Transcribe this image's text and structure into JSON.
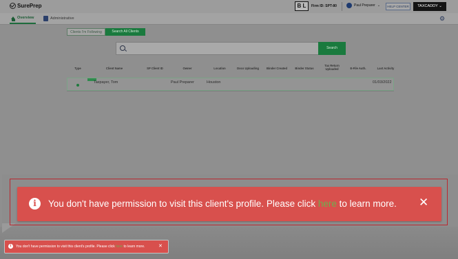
{
  "header": {
    "logo_text": "SurePrep",
    "firm_badge": "B L",
    "firm_id": "Firm ID: SPT-80",
    "user_name": "Paul Preparer",
    "help_label": "HELP CENTER",
    "brand_menu_label": "TAXCADDY"
  },
  "nav": {
    "tabs": [
      {
        "label": "Overview",
        "icon": "home-icon",
        "active": true
      },
      {
        "label": "Administrative",
        "icon": "id-card-icon",
        "active": false
      }
    ],
    "settings_icon": "gear-icon"
  },
  "toggle": {
    "following_label": "Clients I'm Following",
    "all_label": "Search All Clients"
  },
  "search": {
    "placeholder": "",
    "button_label": "Search"
  },
  "table": {
    "columns": [
      "Type",
      "Client Name",
      "SP Client ID",
      "Owner",
      "Location",
      "Docs Uploading",
      "Binder Created",
      "Binder Status",
      "Tax Return Uploaded",
      "E-File Auth.",
      "Last Activity"
    ],
    "rows": [
      {
        "client_name": "Taxpayer, Tom",
        "sp_client_id": "",
        "owner": "Paul Preparer",
        "location": "Houston",
        "last_activity": "01/03/2022"
      }
    ]
  },
  "toast": {
    "message_before": "You don't have permission to visit this client's profile. Please click ",
    "link_text": "here",
    "message_after": " to learn more.",
    "colors": {
      "background": "#d8504d",
      "link": "#6fae4f"
    }
  },
  "colors": {
    "brand_green": "#1a7a3e",
    "overlay_gray": "#8f8f8f"
  }
}
